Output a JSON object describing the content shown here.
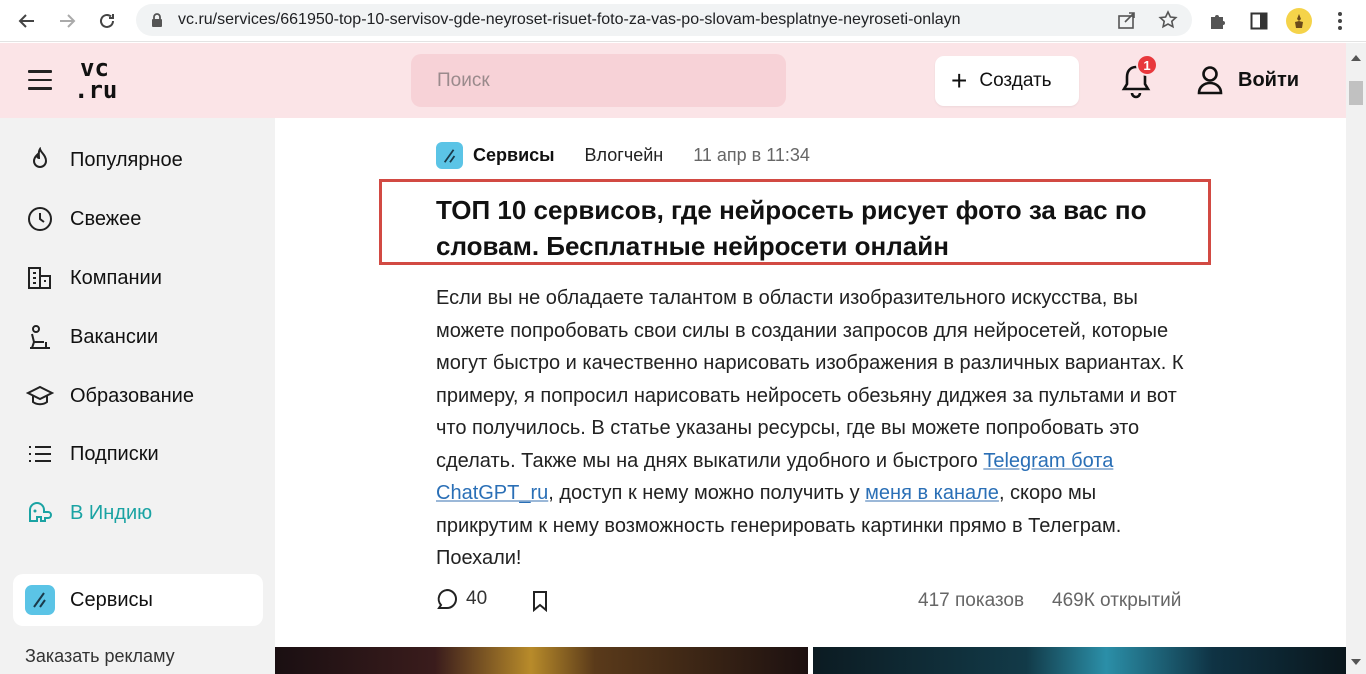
{
  "browser": {
    "url": "vc.ru/services/661950-top-10-servisov-gde-neyroset-risuet-foto-za-vas-po-slovam-besplatnye-neyroseti-onlayn"
  },
  "header": {
    "logo_top": "vc",
    "logo_bottom": ".ru",
    "search_placeholder": "Поиск",
    "create_label": "Создать",
    "notifications_count": "1",
    "login_label": "Войти",
    "background_color": "#fbe4e7"
  },
  "sidebar": {
    "items": [
      {
        "label": "Популярное",
        "icon": "flame-icon"
      },
      {
        "label": "Свежее",
        "icon": "clock-icon"
      },
      {
        "label": "Компании",
        "icon": "buildings-icon"
      },
      {
        "label": "Вакансии",
        "icon": "chair-icon"
      },
      {
        "label": "Образование",
        "icon": "graduation-cap-icon"
      },
      {
        "label": "Подписки",
        "icon": "list-icon"
      },
      {
        "label": "В Индию",
        "icon": "elephant-icon"
      }
    ],
    "active_item": {
      "label": "Сервисы",
      "icon": "services-icon"
    },
    "ads_link": "Заказать рекламу",
    "accent_color": "#1aa3a3"
  },
  "article": {
    "category": "Сервисы",
    "author": "Влогчейн",
    "date": "11 апр в 11:34",
    "title": "ТОП 10 сервисов, где нейросеть рисует фото за вас по словам. Бесплатные нейросети онлайн",
    "body_part1": "Если вы не обладаете талантом в области изобразительного искусства, вы можете попробовать свои силы в создании запросов для нейросетей, которые могут быстро и качественно нарисовать изображения в различных вариантах. К примеру, я попросил нарисовать нейросеть обезьяну диджея за пультами и вот что получилось. В статье указаны ресурсы, где вы можете попробовать это сделать. Также мы на днях выкатили удобного и быстрого ",
    "link1": "Telegram бота ChatGPT_ru",
    "body_part2": ", доступ к нему можно получить у ",
    "link2": "меня в канале",
    "body_part3": ", скоро мы прикрутим к нему возможность генерировать картинки прямо в Телеграм. Поехали!",
    "comments_count": "40",
    "views": "417 показов",
    "opens": "469К открытий",
    "highlight_color": "#d24a43",
    "link_color": "#2a6fb6"
  }
}
